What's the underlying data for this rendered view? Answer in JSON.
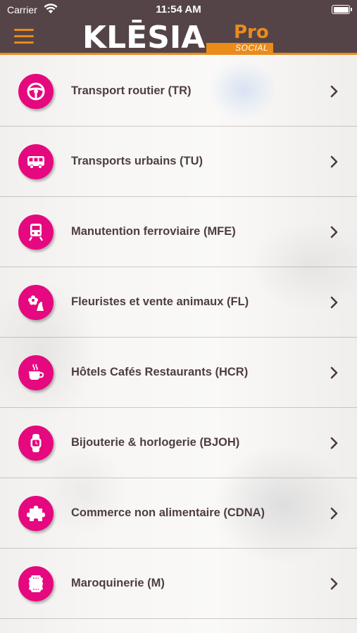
{
  "status_bar": {
    "carrier": "Carrier",
    "time": "11:54 AM"
  },
  "header": {
    "logo_text": "KLĒSIA",
    "logo_pro": "Pro",
    "logo_social": "SOCIAL",
    "menu_icon": "hamburger-menu-icon"
  },
  "colors": {
    "accent": "#e5087f",
    "brand_orange": "#ea8b1a",
    "header_bg": "#544447",
    "text": "#4e3e40"
  },
  "sectors": [
    {
      "label": "Transport routier (TR)",
      "icon": "steering-wheel-icon"
    },
    {
      "label": "Transports urbains (TU)",
      "icon": "bus-icon"
    },
    {
      "label": "Manutention ferroviaire (MFE)",
      "icon": "train-icon"
    },
    {
      "label": "Fleuristes et vente animaux (FL)",
      "icon": "flower-animal-icon"
    },
    {
      "label": "Hôtels Cafés Restaurants (HCR)",
      "icon": "coffee-cup-icon"
    },
    {
      "label": "Bijouterie & horlogerie (BJOH)",
      "icon": "watch-icon"
    },
    {
      "label": "Commerce non alimentaire (CDNA)",
      "icon": "puzzle-icon"
    },
    {
      "label": "Maroquinerie (M)",
      "icon": "leather-icon"
    }
  ]
}
